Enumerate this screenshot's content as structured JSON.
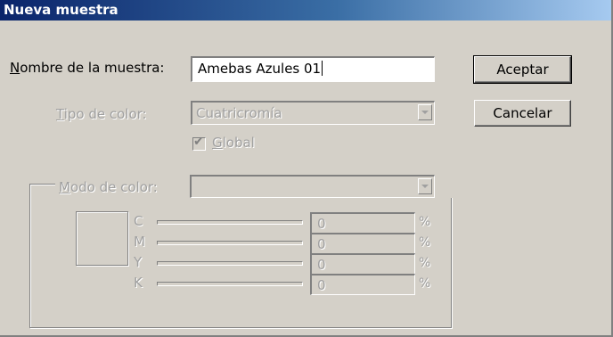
{
  "window": {
    "title": "Nueva muestra"
  },
  "name_field": {
    "label": "Nombre de la muestra:",
    "label_first": "N",
    "label_rest": "ombre de la muestra:",
    "value": "Amebas Azules 01"
  },
  "color_type": {
    "label_first": "T",
    "label_rest": "ipo de color:",
    "value": "Cuatricromía"
  },
  "global": {
    "label_first": "G",
    "label_rest": "lobal",
    "checked": true
  },
  "color_mode": {
    "label_first": "M",
    "label_rest": "odo de color:",
    "value": ""
  },
  "buttons": {
    "ok": "Aceptar",
    "cancel": "Cancelar"
  },
  "channels": [
    {
      "letter": "C",
      "value": "0",
      "unit": "%"
    },
    {
      "letter": "M",
      "value": "0",
      "unit": "%"
    },
    {
      "letter": "Y",
      "value": "0",
      "unit": "%"
    },
    {
      "letter": "K",
      "value": "0",
      "unit": "%"
    }
  ],
  "colors": {
    "face": "#d4d0c8",
    "title_start": "#0a246a",
    "title_end": "#a6caf0",
    "disabled_text": "#a0a0a0"
  }
}
